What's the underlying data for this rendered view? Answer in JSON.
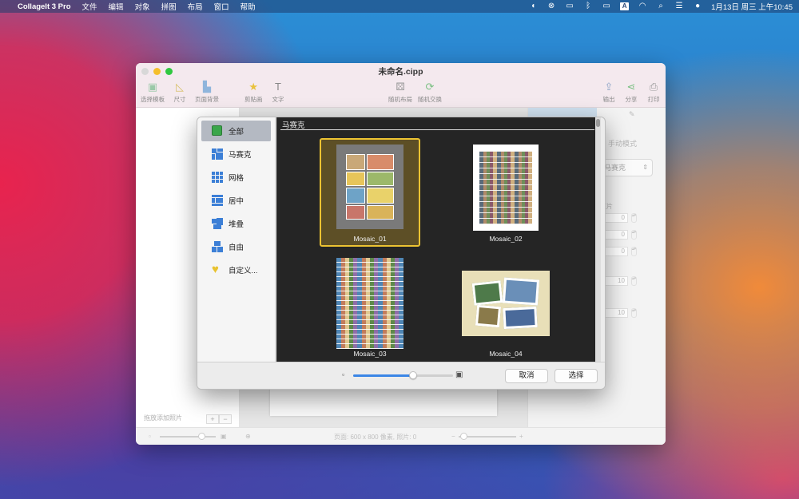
{
  "menubar": {
    "app_name": "CollageIt 3 Pro",
    "menus": [
      "文件",
      "编辑",
      "对象",
      "拼图",
      "布局",
      "窗口",
      "帮助"
    ],
    "clock": "1月13日 周三 上午10:45",
    "input_method": "A"
  },
  "window": {
    "title": "未命名.cipp",
    "toolbar": {
      "choose_template": "选择模板",
      "size": "尺寸",
      "page_background": "页面背景",
      "clipart": "剪贴画",
      "text": "文字",
      "random_layout": "随机布局",
      "random_swap": "随机交换",
      "export": "输出",
      "share": "分享",
      "print": "打印"
    },
    "left_pane": {
      "drop_hint": "拖放添加照片",
      "add": "+",
      "remove": "−"
    },
    "right_pane": {
      "mode_label": "手动模式",
      "style_select": "马赛克",
      "photos_label": "照片",
      "values": [
        "0",
        "0",
        "0",
        "10",
        "10"
      ]
    },
    "statusbar": {
      "page_info": "页面: 600 x 800 像素, 照片: 0",
      "minus": "−",
      "plus": "+"
    }
  },
  "sheet": {
    "categories": [
      {
        "label": "全部",
        "icon": "all-icon"
      },
      {
        "label": "马赛克",
        "icon": "mosaic-icon"
      },
      {
        "label": "网格",
        "icon": "grid-icon"
      },
      {
        "label": "居中",
        "icon": "center-icon"
      },
      {
        "label": "堆叠",
        "icon": "stack-icon"
      },
      {
        "label": "自由",
        "icon": "free-icon"
      },
      {
        "label": "自定义...",
        "icon": "heart-icon"
      }
    ],
    "selected_category": "全部",
    "section_header": "马赛克",
    "templates": [
      {
        "name": "Mosaic_01",
        "selected": true
      },
      {
        "name": "Mosaic_02",
        "selected": false
      },
      {
        "name": "Mosaic_03",
        "selected": false
      },
      {
        "name": "Mosaic_04",
        "selected": false
      }
    ],
    "thumbnail_size_fraction": 0.6,
    "buttons": {
      "cancel": "取消",
      "select": "选择"
    }
  },
  "colors": {
    "accent": "#3b86e6",
    "selection_border": "#ecc332",
    "gallery_bg": "#252525"
  }
}
